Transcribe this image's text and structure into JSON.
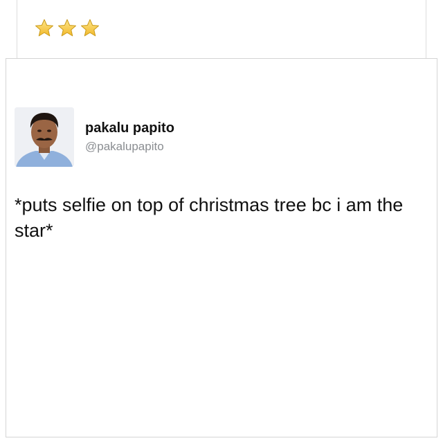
{
  "header": {
    "rating": {
      "value": 3,
      "max": 3
    },
    "star_icon": "star-icon",
    "star_color": "#f4c22b"
  },
  "tweet": {
    "display_name": "pakalu papito",
    "handle": "@pakalupapito",
    "text": "*puts selfie on top of christmas tree bc i am the star*",
    "avatar_icon": "avatar-photo"
  }
}
